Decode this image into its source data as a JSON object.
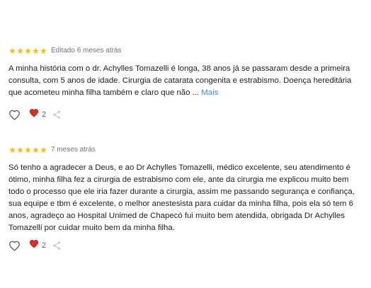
{
  "reviews": [
    {
      "rating": 5,
      "timestamp": "Editado 6 meses atrás",
      "text": "A minha história com o dr. Achylles Tomazelli é longa, 38 anos já se passaram desde a primeira consulta, com 5 anos de idade. Cirurgia de catarata congenita e estrabismo. Doença hereditária que acometeu minha filha também e claro que não ...",
      "more_label": "Mais",
      "reaction_count": "2"
    },
    {
      "rating": 5,
      "timestamp": "7 meses atrás",
      "text": "Só tenho a agradecer a Deus, e ao Dr Achylles Tomazelli, médico excelente, seu atendimento é ótimo, minha filha fez a cirurgia de estrabismo com ele, ante da cirurgia me explicou muito bem todo o processo que ele iria fazer durante a cirurgia, assim me passando segurança e confiança, sua equipe e tbm é excelente, o melhor anestesista para cuidar da minha filha, pois ela só tem 6 anos, agradeço ao Hospital Unimed de Chapecó fui muito bem atendida, obrigada Dr Achylles Tomazelli por cuidar muito bem da minha filha.",
      "reaction_count": "2"
    }
  ],
  "icons": {
    "star": "star-icon",
    "like": "heart-outline-icon",
    "reaction": "red-heart-icon",
    "share": "share-icon"
  },
  "colors": {
    "star": "#fbbc04",
    "link": "#4285f4",
    "heart_red": "#d93025",
    "muted": "#70757a"
  }
}
